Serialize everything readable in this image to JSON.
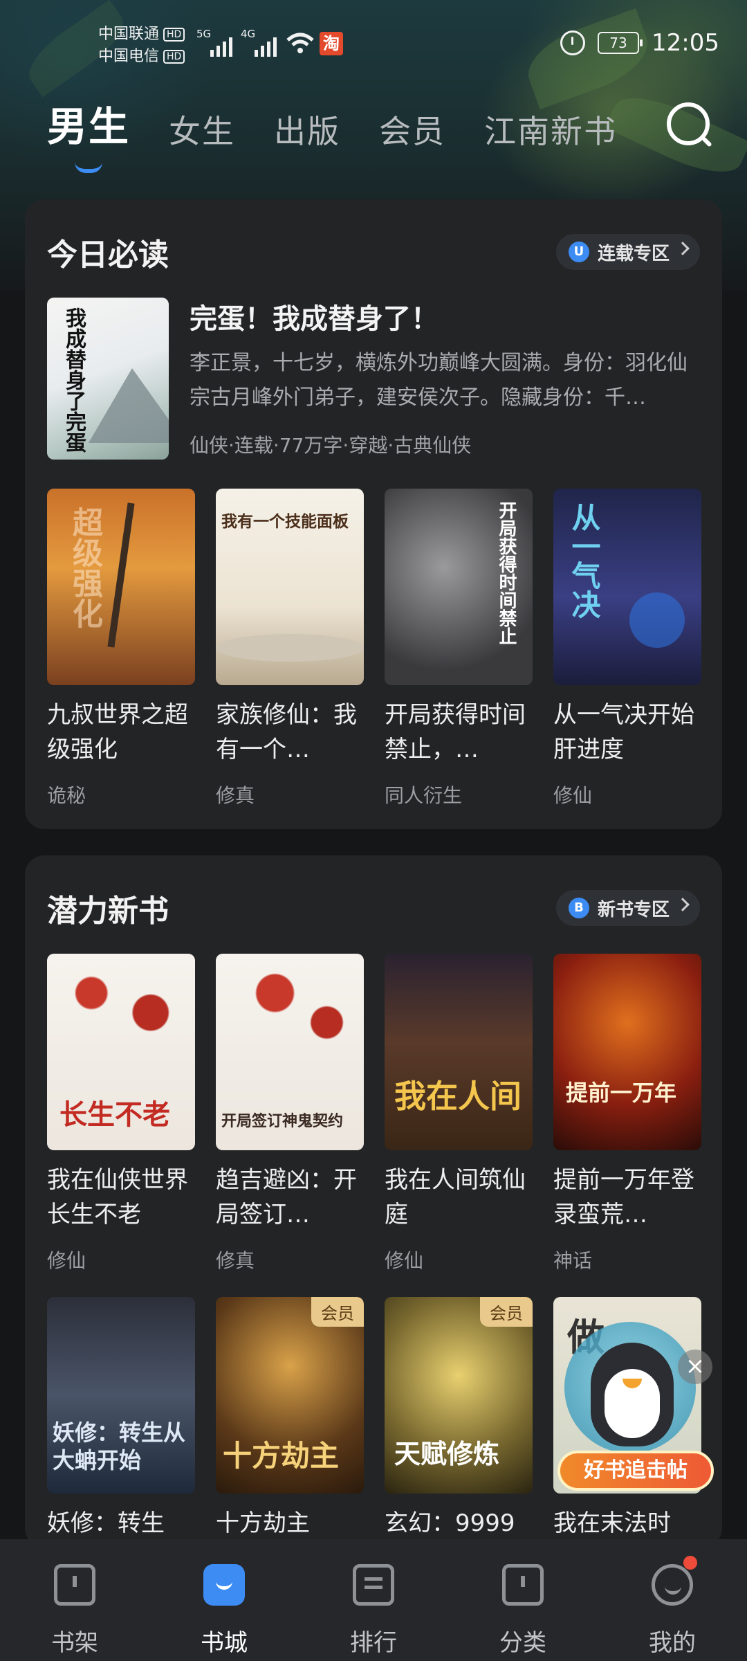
{
  "status_bar": {
    "carrier1": "中国联通",
    "carrier2": "中国电信",
    "hd": "HD",
    "net1": "5G",
    "net2": "4G",
    "taobao_icon": "淘",
    "battery": "73",
    "time": "12:05"
  },
  "top_tabs": [
    "男生",
    "女生",
    "出版",
    "会员",
    "江南新书"
  ],
  "today": {
    "title": "今日必读",
    "zone_icon": "U",
    "zone_label": "连载专区",
    "featured": {
      "cover_text": "我成替身了完蛋",
      "title": "完蛋！我成替身了！",
      "desc": "李正景，十七岁，横炼外功巅峰大圆满。身份：羽化仙宗古月峰外门弟子，建安侯次子。隐藏身份：千…",
      "tags": "仙侠·连载·77万字·穿越·古典仙侠"
    },
    "books": [
      {
        "title": "九叔世界之超级强化",
        "tag": "诡秘",
        "cover_text": "超级强化"
      },
      {
        "title": "家族修仙：我有一个…",
        "tag": "修真",
        "cover_text": "我有一个技能面板"
      },
      {
        "title": "开局获得时间禁止，…",
        "tag": "同人衍生",
        "cover_text": "开局获得时间禁止"
      },
      {
        "title": "从一气决开始肝进度",
        "tag": "修仙",
        "cover_text": "从一气决"
      }
    ]
  },
  "potential": {
    "title": "潜力新书",
    "zone_icon": "B",
    "zone_label": "新书专区",
    "books": [
      {
        "title": "我在仙侠世界长生不老",
        "tag": "修仙",
        "cover_text": "长生不老"
      },
      {
        "title": "趋吉避凶：开局签订…",
        "tag": "修真",
        "cover_text": "开局签订神鬼契约"
      },
      {
        "title": "我在人间筑仙庭",
        "tag": "修仙",
        "cover_text": "我在人间"
      },
      {
        "title": "提前一万年登录蛮荒…",
        "tag": "神话",
        "cover_text": "提前一万年"
      },
      {
        "title": "妖修：转生",
        "vip": "",
        "cover_text": "妖修：转生从大蚺开始"
      },
      {
        "title": "十方劫主",
        "vip": "会员",
        "cover_text": "十方劫主"
      },
      {
        "title": "玄幻：9999",
        "vip": "会员",
        "cover_text": "天赋修炼"
      },
      {
        "title": "我在末法时",
        "vip": "",
        "cover_text": "做"
      }
    ]
  },
  "promo": {
    "label": "好书追击帖",
    "close": "×"
  },
  "bottom_nav": [
    {
      "label": "书架",
      "icon": "book-icon"
    },
    {
      "label": "书城",
      "icon": "store-icon"
    },
    {
      "label": "排行",
      "icon": "rank-icon"
    },
    {
      "label": "分类",
      "icon": "category-icon"
    },
    {
      "label": "我的",
      "icon": "profile-icon"
    }
  ],
  "colors": {
    "accent": "#3c8cf4",
    "card": "#232426",
    "vip": "#e9c98c"
  }
}
